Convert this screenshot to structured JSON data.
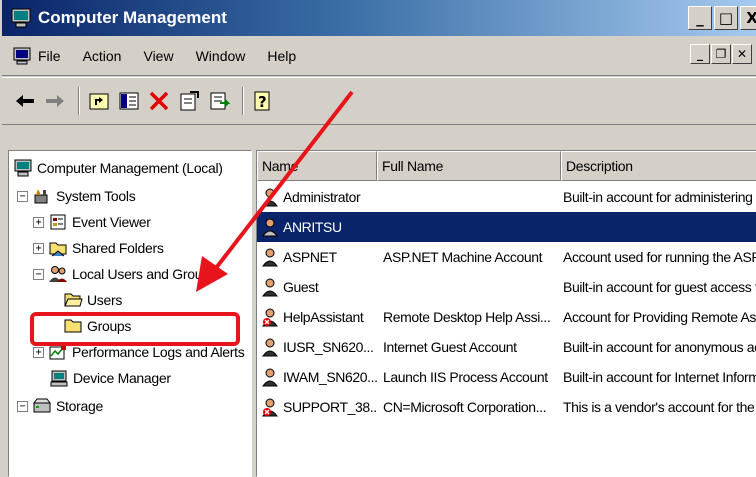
{
  "window": {
    "title": "Computer Management"
  },
  "title_buttons": {
    "minimize": "_",
    "restore": "□",
    "close": "X"
  },
  "menubar": {
    "items": [
      {
        "label": "File"
      },
      {
        "label": "Action"
      },
      {
        "label": "View"
      },
      {
        "label": "Window"
      },
      {
        "label": "Help"
      }
    ],
    "mdi_buttons": {
      "minimize": "_",
      "restore": "❐",
      "close": "✕"
    }
  },
  "toolbar": {
    "icons": [
      "back-arrow-icon",
      "forward-arrow-icon",
      "up-folder-icon",
      "show-hide-tree-icon",
      "delete-icon",
      "properties-icon",
      "export-list-icon",
      "help-icon"
    ]
  },
  "tree": {
    "root": "Computer Management (Local)",
    "system_tools": "System Tools",
    "event_viewer": "Event Viewer",
    "shared_folders": "Shared Folders",
    "local_users_groups": "Local Users and Groups",
    "users": "Users",
    "groups": "Groups",
    "perf_logs": "Performance Logs and Alerts",
    "device_manager": "Device Manager",
    "storage": "Storage"
  },
  "list": {
    "columns": {
      "name": "Name",
      "full_name": "Full Name",
      "description": "Description"
    },
    "rows": [
      {
        "name": "Administrator",
        "full_name": "",
        "description": "Built-in account for administering th",
        "disabled": false,
        "selected": false
      },
      {
        "name": "ANRITSU",
        "full_name": "",
        "description": "",
        "disabled": false,
        "selected": true
      },
      {
        "name": "ASPNET",
        "full_name": "ASP.NET Machine Account",
        "description": "Account used for running the ASP.",
        "disabled": false,
        "selected": false
      },
      {
        "name": "Guest",
        "full_name": "",
        "description": "Built-in account for guest access to",
        "disabled": false,
        "selected": false
      },
      {
        "name": "HelpAssistant",
        "full_name": "Remote Desktop Help Assi...",
        "description": "Account for Providing Remote Assi",
        "disabled": true,
        "selected": false
      },
      {
        "name": "IUSR_SN620...",
        "full_name": "Internet Guest Account",
        "description": "Built-in account for anonymous acc",
        "disabled": false,
        "selected": false
      },
      {
        "name": "IWAM_SN620...",
        "full_name": "Launch IIS Process Account",
        "description": "Built-in account for Internet Inform",
        "disabled": false,
        "selected": false
      },
      {
        "name": "SUPPORT_38...",
        "full_name": "CN=Microsoft Corporation...",
        "description": "This is a vendor's account for the H",
        "disabled": true,
        "selected": false
      }
    ]
  },
  "annotation": {
    "highlight_color": "#e8141c"
  },
  "colors": {
    "title_start": "#0a246a",
    "title_end": "#a6caf0",
    "selection": "#0a246a",
    "chrome": "#d4d0c8"
  }
}
